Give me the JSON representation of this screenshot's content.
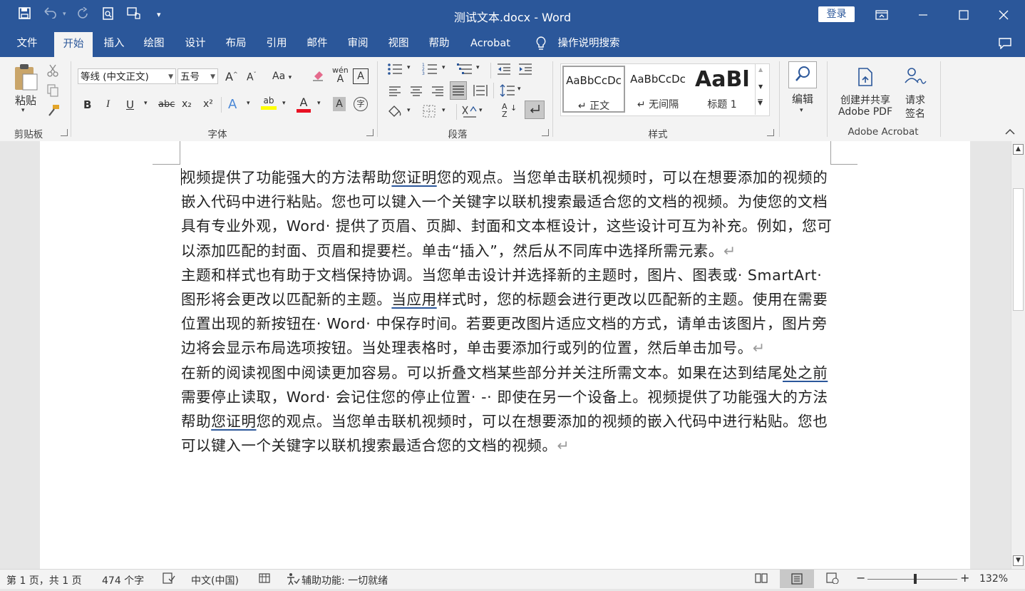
{
  "titlebar": {
    "title": "测试文本.docx  -  Word",
    "login": "登录"
  },
  "tabs": [
    "文件",
    "开始",
    "插入",
    "绘图",
    "设计",
    "布局",
    "引用",
    "邮件",
    "审阅",
    "视图",
    "帮助",
    "Acrobat",
    "操作说明搜索"
  ],
  "ribbon": {
    "clipboard": {
      "paste": "粘贴",
      "label": "剪贴板"
    },
    "font": {
      "name": "等线 (中文正文)",
      "size": "五号",
      "label": "字体",
      "aa": "Aa",
      "bold": "B",
      "italic": "I",
      "underline": "U",
      "strike": "abc",
      "sub": "x₂",
      "sup": "x²",
      "wen": "wén",
      "wen_a": "A",
      "colorA": "A",
      "shadeA": "A",
      "enclose": "字"
    },
    "paragraph": {
      "label": "段落"
    },
    "styles": {
      "label": "样式",
      "items": [
        {
          "sample": "AaBbCcDc",
          "name": "↵ 正文"
        },
        {
          "sample": "AaBbCcDc",
          "name": "↵ 无间隔"
        },
        {
          "sample": "AaBl",
          "name": "标题 1"
        }
      ]
    },
    "editing": {
      "label": "编辑"
    },
    "acrobat": {
      "create": "创建并共享\nAdobe PDF",
      "create1": "创建并共享",
      "create2": "Adobe PDF",
      "sign1": "请求",
      "sign2": "签名",
      "label": "Adobe Acrobat"
    }
  },
  "document": {
    "p1a": "视频提供了功能强大的方法帮助",
    "p1u": "您证明",
    "p1b": "您的观点。当您单击联机视频时，可以在想要添加的视频的嵌入代码中进行粘贴。您也可以键入一个关键字以联机搜索最适合您的文档的视频。为使您的文档具有专业外观，Word· 提供了页眉、页脚、封面和文本框设计，这些设计可互为补充。例如，您可以添加匹配的封面、页眉和提要栏。单击“插入”，然后从不同库中选择所需元素。",
    "p2a": "主题和样式也有助于文档保持协调。当您单击设计并选择新的主题时，图片、图表或· SmartArt· 图形将会更改以匹配新的主题。",
    "p2u": "当应用",
    "p2b": "样式时，您的标题会进行更改以匹配新的主题。使用在需要位置出现的新按钮在· Word· 中保存时间。若要更改图片适应文档的方式，请单击该图片，图片旁边将会显示布局选项按钮。当处理表格时，单击要添加行或列的位置，然后单击加号。",
    "p3a": "在新的阅读视图中阅读更加容易。可以折叠文档某些部分并关注所需文本。如果在达到结尾",
    "p3u": "处之前",
    "p3b": "需要停止读取，Word· 会记住您的停止位置· -· 即使在另一个设备上。视频提供了功能强大的方法帮助",
    "p3u2": "您证明",
    "p3c": "您的观点。当您单击联机视频时，可以在想要添加的视频的嵌入代码中进行粘贴。您也可以键入一个关键字以联机搜索最适合您的文档的视频。",
    "pilcrow": "↵"
  },
  "status": {
    "page": "第 1 页，共 1 页",
    "words": "474 个字",
    "lang": "中文(中国)",
    "access": "辅助功能: 一切就绪",
    "zoom": "132%",
    "minus": "−",
    "plus": "+"
  }
}
